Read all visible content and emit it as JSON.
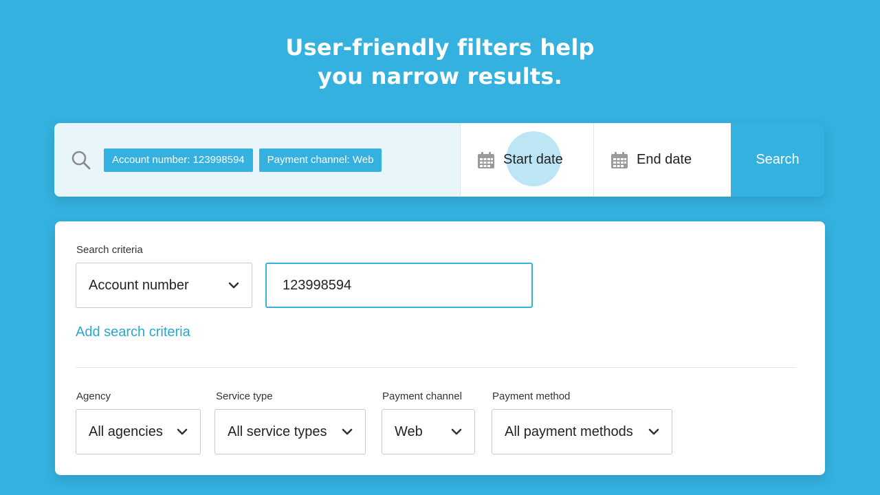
{
  "headline": {
    "line1": "User-friendly filters help",
    "line2": "you narrow results."
  },
  "searchbar": {
    "icon": "search-icon",
    "chips": [
      {
        "label": "Account number: 123998594"
      },
      {
        "label": "Payment channel: Web"
      }
    ],
    "start_date": "Start date",
    "end_date": "End date",
    "search_button": "Search"
  },
  "criteria": {
    "section_label": "Search criteria",
    "criteria_select": "Account number",
    "criteria_value": "123998594",
    "add_link": "Add search criteria"
  },
  "filters": {
    "agency": {
      "label": "Agency",
      "value": "All agencies"
    },
    "service_type": {
      "label": "Service type",
      "value": "All service types"
    },
    "payment_channel": {
      "label": "Payment channel",
      "value": "Web"
    },
    "payment_method": {
      "label": "Payment method",
      "value": "All payment methods"
    }
  },
  "colors": {
    "brand": "#34b1df",
    "chip_bg": "#34b1df",
    "searchbar_left_bg": "#e8f5fb",
    "link": "#2aa6cf"
  }
}
